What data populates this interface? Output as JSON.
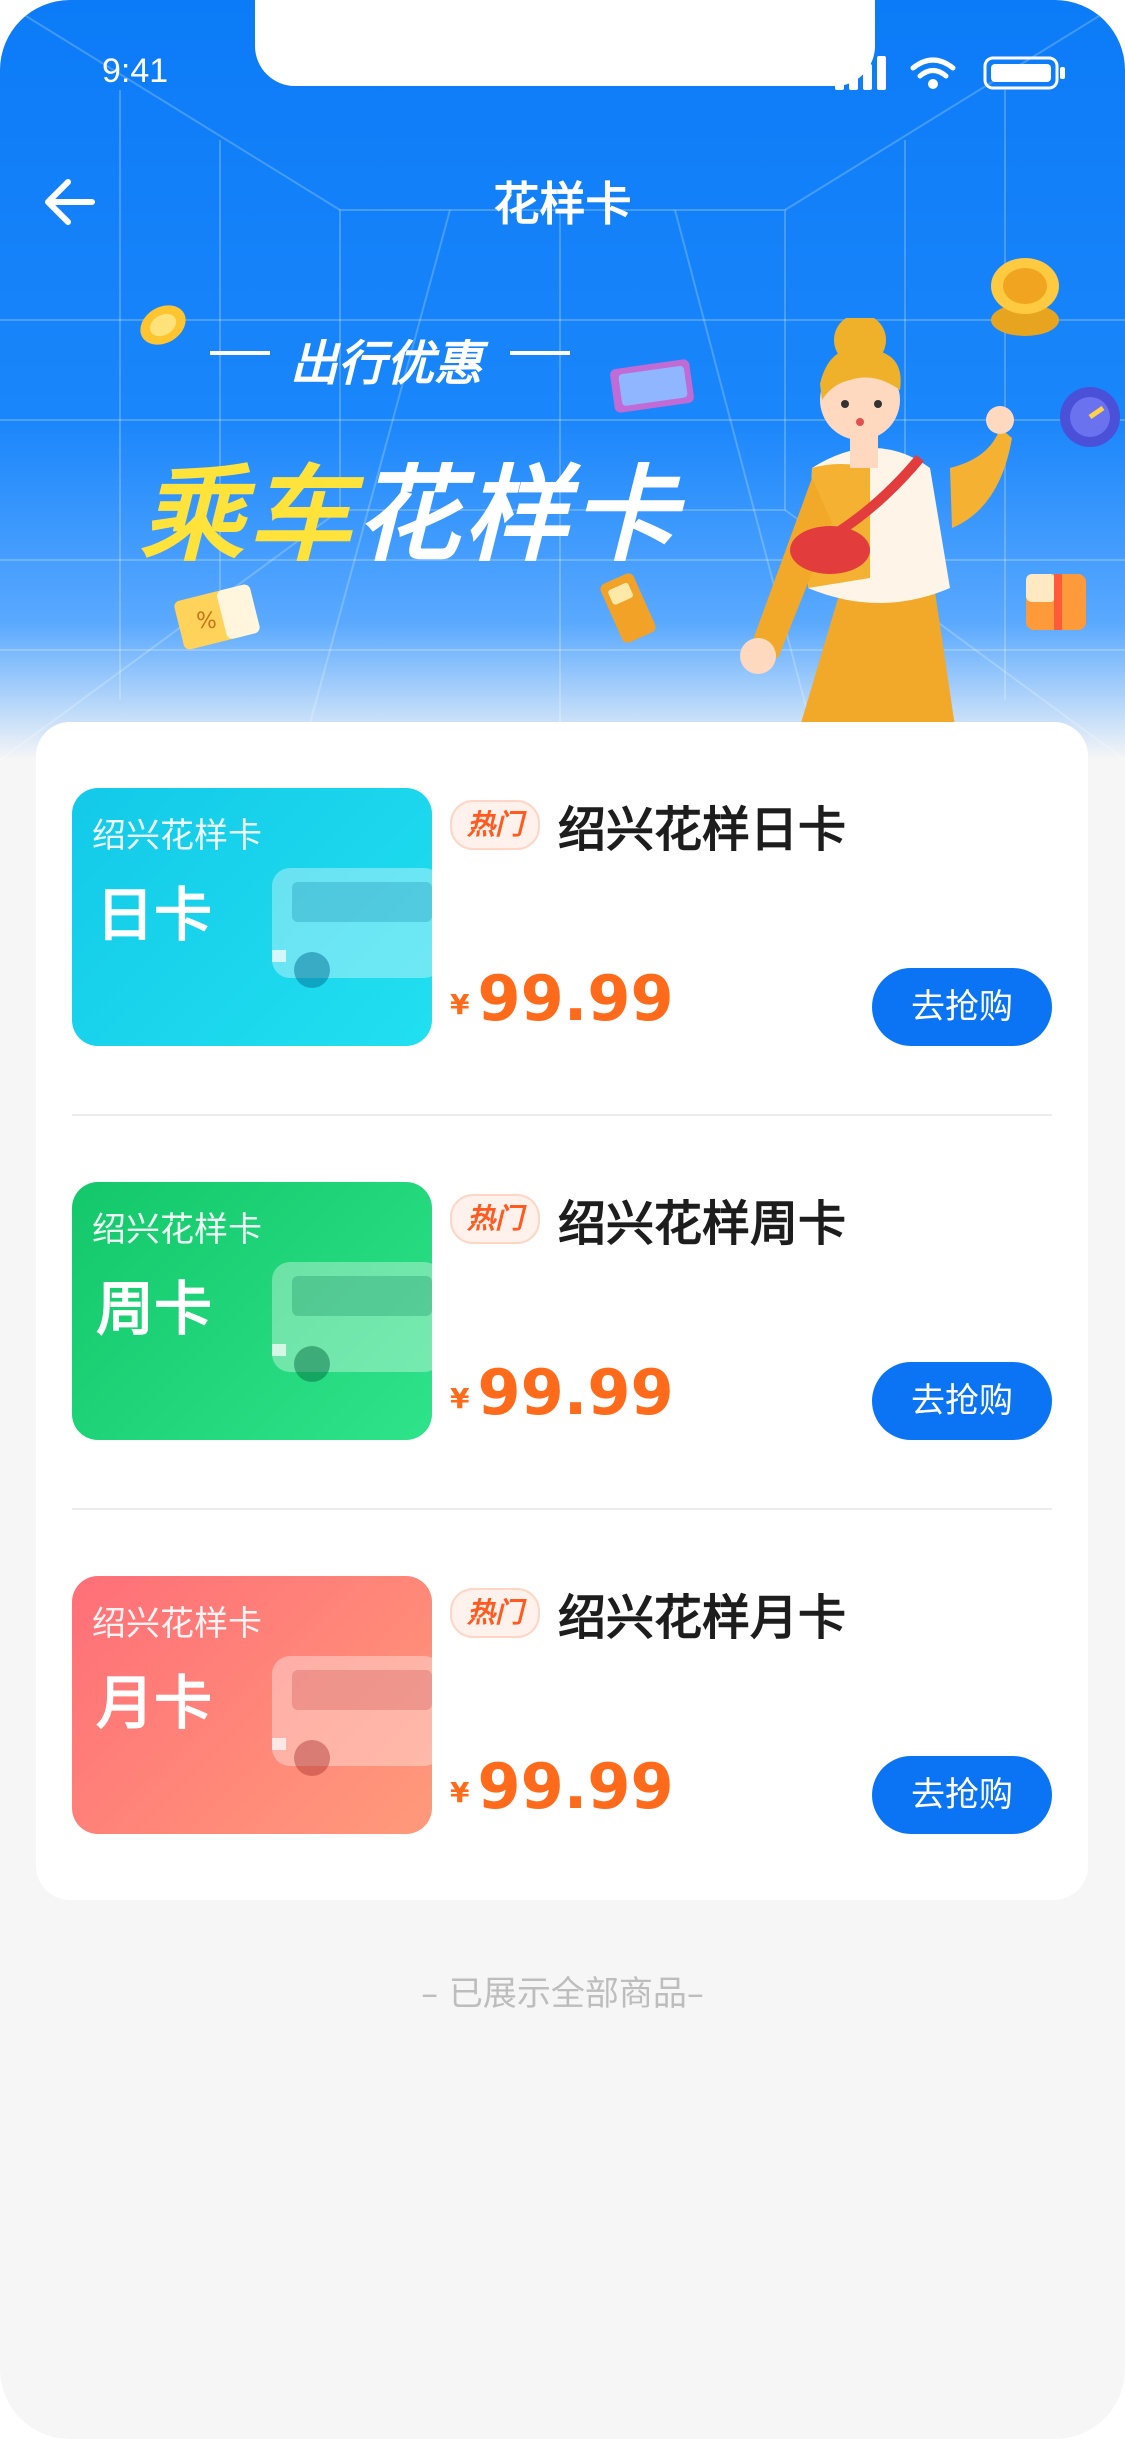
{
  "status_bar": {
    "time": "9:41"
  },
  "header": {
    "title": "花样卡"
  },
  "banner": {
    "tag": "出行优惠",
    "headline_highlight": "乘车",
    "headline_rest": "花样卡"
  },
  "hot_label": "热门",
  "currency": "¥",
  "buy_label": "去抢购",
  "products": [
    {
      "city_label": "绍兴花样卡",
      "card_type": "日卡",
      "name": "绍兴花样日卡",
      "price": "99.99",
      "color_start": "#13c9e8",
      "color_end": "#21e0f0"
    },
    {
      "city_label": "绍兴花样卡",
      "card_type": "周卡",
      "name": "绍兴花样周卡",
      "price": "99.99",
      "color_start": "#13c76a",
      "color_end": "#2ee38a"
    },
    {
      "city_label": "绍兴花样卡",
      "card_type": "月卡",
      "name": "绍兴花样月卡",
      "price": "99.99",
      "color_start": "#ff6f78",
      "color_end": "#ff9a7a"
    }
  ],
  "footer": {
    "text": "– 已展示全部商品–"
  },
  "colors": {
    "brand_blue": "#0b74f5",
    "price_orange": "#ff6b1a"
  }
}
